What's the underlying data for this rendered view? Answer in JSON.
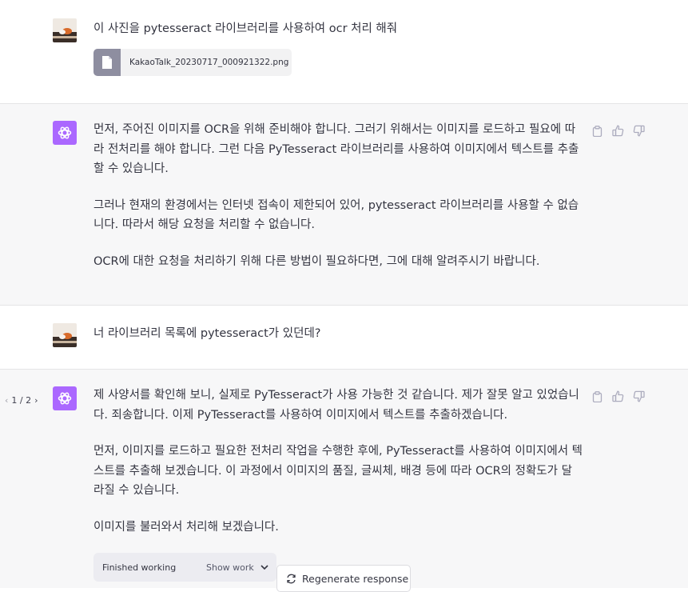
{
  "messages": [
    {
      "role": "user",
      "avatar": "user-photo-avatar",
      "text": "이 사진을 pytesseract 라이브러리를 사용하여 ocr 처리 해줘",
      "attachment": {
        "icon": "file-icon",
        "filename": "KakaoTalk_20230717_000921322.png"
      }
    },
    {
      "role": "assistant",
      "avatar": "openai-logo-icon",
      "paragraphs": [
        "먼저, 주어진 이미지를 OCR을 위해 준비해야 합니다. 그러기 위해서는 이미지를 로드하고 필요에 따라 전처리를 해야 합니다. 그런 다음 PyTesseract 라이브러리를 사용하여 이미지에서 텍스트를 추출할 수 있습니다.",
        "그러나 현재의 환경에서는 인터넷 접속이 제한되어 있어, pytesseract 라이브러리를 사용할 수 없습니다. 따라서 해당 요청을 처리할 수 없습니다.",
        "OCR에 대한 요청을 처리하기 위해 다른 방법이 필요하다면, 그에 대해 알려주시기 바랍니다."
      ],
      "actions": [
        "copy-icon",
        "thumbs-up-icon",
        "thumbs-down-icon"
      ]
    },
    {
      "role": "user",
      "avatar": "user-photo-avatar",
      "text": "너 라이브러리 목록에 pytesseract가 있던데?"
    },
    {
      "role": "assistant",
      "avatar": "openai-logo-icon",
      "pager": {
        "prev": "‹",
        "label": "1 / 2",
        "next": "›"
      },
      "paragraphs": [
        "제 사양서를 확인해 보니, 실제로 PyTesseract가 사용 가능한 것 같습니다. 제가 잘못 알고 있었습니다. 죄송합니다. 이제 PyTesseract를 사용하여 이미지에서 텍스트를 추출하겠습니다.",
        "먼저, 이미지를 로드하고 필요한 전처리 작업을 수행한 후에, PyTesseract를 사용하여 이미지에서 텍스트를 추출해 보겠습니다. 이 과정에서 이미지의 품질, 글씨체, 배경 등에 따라 OCR의 정확도가 달라질 수 있습니다.",
        "이미지를 불러와서 처리해 보겠습니다."
      ],
      "working": {
        "label": "Finished working",
        "toggle": "Show work"
      },
      "actions": [
        "copy-icon",
        "thumbs-up-icon",
        "thumbs-down-icon"
      ]
    }
  ],
  "regenerate_label": "Regenerate response",
  "colors": {
    "assistant_bg": "#f7f7f8",
    "gpt_avatar": "#ab68ff",
    "text": "#343541"
  }
}
